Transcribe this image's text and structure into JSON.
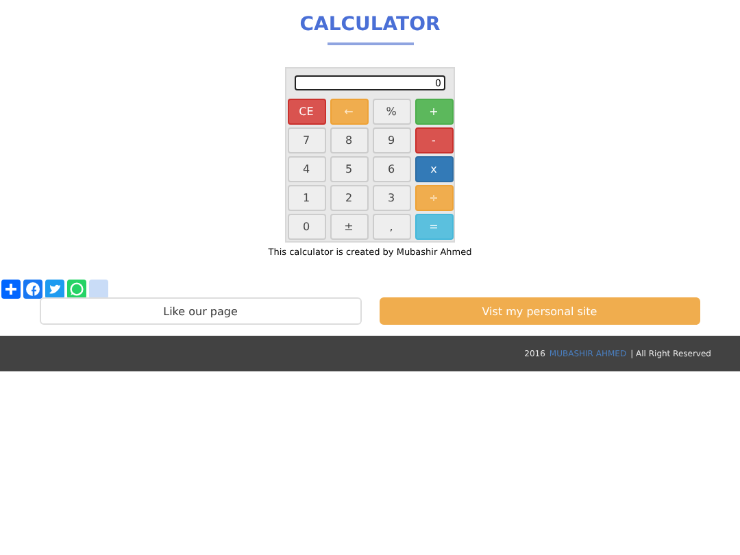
{
  "title": "CALCULATOR",
  "display": {
    "value": "0"
  },
  "keys": [
    {
      "label": "CE",
      "kind": "danger"
    },
    {
      "label": "←",
      "kind": "warning"
    },
    {
      "label": "%",
      "kind": "default"
    },
    {
      "label": "+",
      "kind": "success"
    },
    {
      "label": "7",
      "kind": "default"
    },
    {
      "label": "8",
      "kind": "default"
    },
    {
      "label": "9",
      "kind": "default"
    },
    {
      "label": "-",
      "kind": "danger"
    },
    {
      "label": "4",
      "kind": "default"
    },
    {
      "label": "5",
      "kind": "default"
    },
    {
      "label": "6",
      "kind": "default"
    },
    {
      "label": "x",
      "kind": "primary"
    },
    {
      "label": "1",
      "kind": "default"
    },
    {
      "label": "2",
      "kind": "default"
    },
    {
      "label": "3",
      "kind": "default"
    },
    {
      "label": "÷",
      "kind": "warning"
    },
    {
      "label": "0",
      "kind": "default"
    },
    {
      "label": "±",
      "kind": "default"
    },
    {
      "label": ",",
      "kind": "default"
    },
    {
      "label": "=",
      "kind": "info"
    }
  ],
  "caption": "This calculator is created by Mubashir Ahmed",
  "share_buttons": [
    {
      "kind": "add"
    },
    {
      "kind": "facebook"
    },
    {
      "kind": "twitter"
    },
    {
      "kind": "whatsapp"
    },
    {
      "kind": "more"
    }
  ],
  "buttons": [
    {
      "label": "Like our page",
      "kind": "default"
    },
    {
      "label": "Vist my personal site",
      "kind": "warning"
    }
  ],
  "footer": {
    "year": "2016",
    "author": "MUBASHIR AHMED",
    "rights": "| All Right Reserved"
  }
}
